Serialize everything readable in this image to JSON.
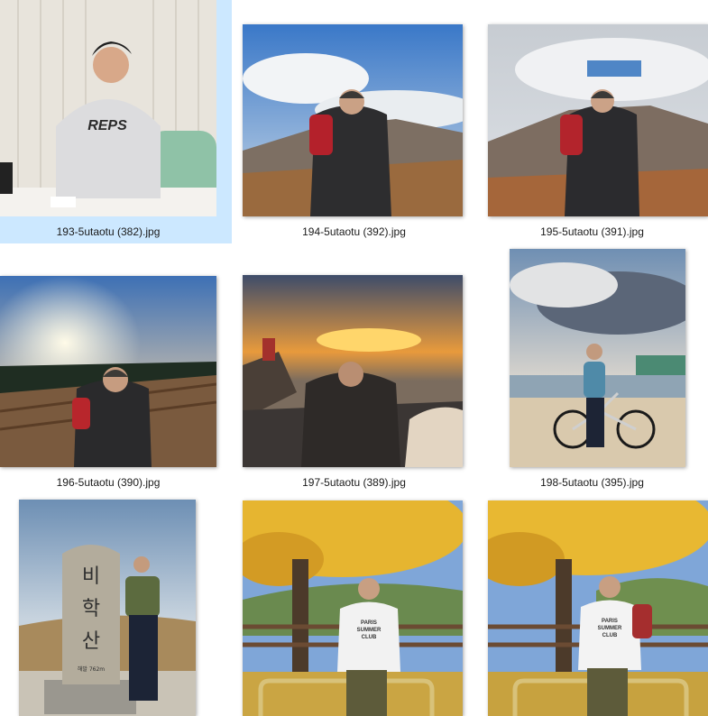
{
  "files": [
    {
      "name": "193-5utaotu (382).jpg",
      "selected": true
    },
    {
      "name": "194-5utaotu (392).jpg"
    },
    {
      "name": "195-5utaotu (391).jpg"
    },
    {
      "name": "196-5utaotu (390).jpg"
    },
    {
      "name": "197-5utaotu (389).jpg"
    },
    {
      "name": "198-5utaotu (395).jpg"
    },
    {
      "name": ""
    },
    {
      "name": ""
    },
    {
      "name": ""
    }
  ],
  "photo_text": {
    "shirt_reps": "REPS",
    "stone_line1": "비",
    "stone_line2": "학",
    "stone_line3": "산",
    "stone_small": "해발 762m",
    "shirt_paris": "PARIS",
    "shirt_summer": "SUMMER",
    "shirt_club": "CLUB"
  },
  "colors": {
    "selection": "#cce8ff",
    "caption_text": "#1a1a1a"
  }
}
